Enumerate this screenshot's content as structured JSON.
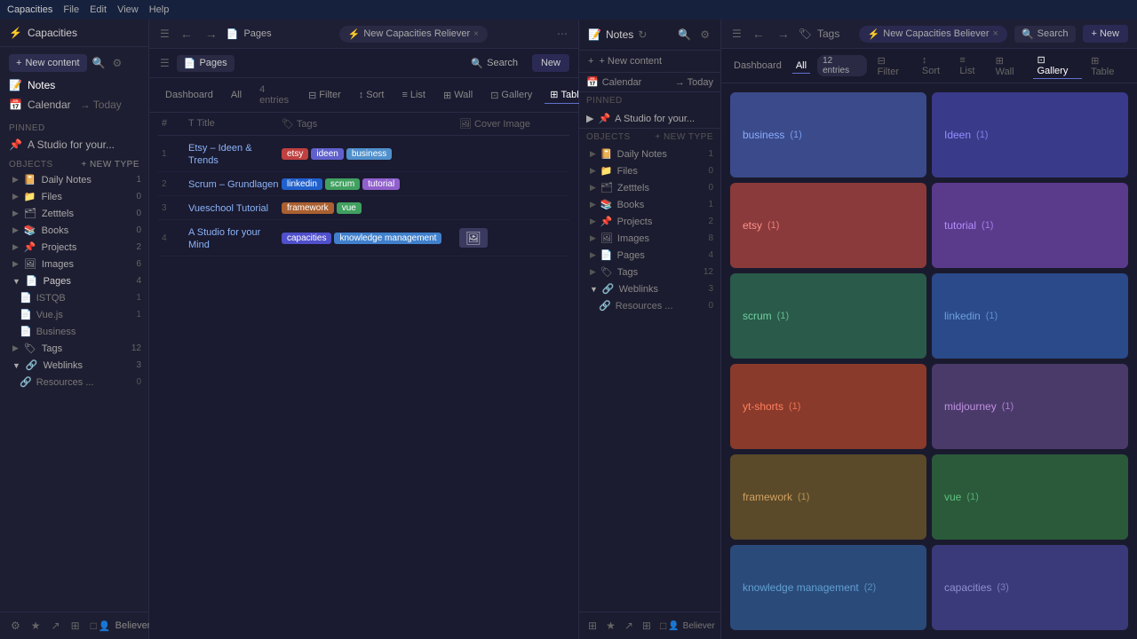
{
  "app": {
    "title": "Capacities",
    "menu": [
      "File",
      "Edit",
      "View",
      "Help"
    ]
  },
  "left_sidebar": {
    "title": "Capacities",
    "nav": [
      {
        "label": "Notes",
        "icon": "📝",
        "active": true
      },
      {
        "label": "Calendar",
        "icon": "📅"
      },
      {
        "label": "Today",
        "icon": "→"
      }
    ],
    "pinned_label": "Pinned",
    "pinned_item": "A Studio for your...",
    "objects_label": "Objects",
    "new_type_label": "+ New type",
    "objects": [
      {
        "label": "Daily Notes",
        "icon": "📔",
        "count": "1",
        "expanded": false
      },
      {
        "label": "Files",
        "icon": "📁",
        "count": "0"
      },
      {
        "label": "Zetttels",
        "icon": "🗂",
        "count": "0"
      },
      {
        "label": "Books",
        "icon": "📚",
        "count": "0"
      },
      {
        "label": "Projects",
        "icon": "📌",
        "count": "2"
      },
      {
        "label": "Images",
        "icon": "🖼",
        "count": "6"
      },
      {
        "label": "Pages",
        "icon": "📄",
        "count": "4",
        "expanded": true,
        "subitems": [
          {
            "label": "ISTQB",
            "count": "1"
          },
          {
            "label": "Vue.js",
            "count": "1"
          },
          {
            "label": "Business",
            "count": ""
          }
        ]
      },
      {
        "label": "Tags",
        "icon": "🏷",
        "count": "12"
      },
      {
        "label": "Weblinks",
        "icon": "🔗",
        "count": "3",
        "expanded": false,
        "subitems": [
          {
            "label": "Resources ...",
            "count": "0"
          }
        ]
      }
    ],
    "footer_icons": [
      "⚙",
      "★",
      "↗",
      "⊞",
      "□"
    ],
    "user": "Believer"
  },
  "center_panel": {
    "titlebar": {
      "nav_icon": "☰",
      "back": "←",
      "forward": "→",
      "breadcrumb": "Pages",
      "active_tab": "New Capacities Reliever",
      "more_icon": "⋯"
    },
    "toolbar": {
      "pages_label": "Pages",
      "search_label": "Search",
      "new_label": "New"
    },
    "view_tabs": [
      {
        "label": "Dashboard",
        "active": false
      },
      {
        "label": "All",
        "active": false
      },
      {
        "label": "4 entries",
        "active": false
      }
    ],
    "view_options": [
      {
        "label": "Filter",
        "icon": "⊟"
      },
      {
        "label": "Sort",
        "icon": "↕"
      },
      {
        "label": "List",
        "icon": "≡"
      },
      {
        "label": "Wall",
        "icon": "⊞"
      },
      {
        "label": "Gallery",
        "icon": "⊡"
      },
      {
        "label": "Table",
        "icon": "⊞",
        "active": true
      }
    ],
    "table": {
      "headers": [
        "#",
        "Title",
        "Tags",
        "Cover Image"
      ],
      "rows": [
        {
          "num": "1",
          "title": "Etsy – Ideen & Trends",
          "tags": [
            {
              "label": "etsy",
              "class": "tag-etsy"
            },
            {
              "label": "ideen",
              "class": "tag-ideen"
            },
            {
              "label": "business",
              "class": "tag-business"
            }
          ],
          "cover": ""
        },
        {
          "num": "2",
          "title": "Scrum – Grundlagen",
          "tags": [
            {
              "label": "linkedin",
              "class": "tag-linkedin"
            },
            {
              "label": "scrum",
              "class": "tag-scrum"
            },
            {
              "label": "tutorial",
              "class": "tag-tutorial"
            }
          ],
          "cover": ""
        },
        {
          "num": "3",
          "title": "Vueschool Tutorial",
          "tags": [
            {
              "label": "framework",
              "class": "tag-framework"
            },
            {
              "label": "vue",
              "class": "tag-vue"
            }
          ],
          "cover": ""
        },
        {
          "num": "4",
          "title": "A Studio for your Mind",
          "tags": [
            {
              "label": "capacities",
              "class": "tag-capacities"
            },
            {
              "label": "knowledge management",
              "class": "tag-km"
            }
          ],
          "cover": "🖼"
        }
      ]
    }
  },
  "notes_panel": {
    "title": "Notes",
    "refresh_icon": "↻",
    "search_icon": "🔍",
    "options_icon": "⚙",
    "new_content_label": "+ New content",
    "calendar_label": "Calendar",
    "today_label": "→ Today",
    "pinned_label": "Pinned",
    "pinned_item": "A Studio for your...",
    "objects_label": "Objects",
    "new_type_label": "+ New type",
    "objects": [
      {
        "label": "Daily Notes",
        "icon": "📔",
        "count": "1",
        "expanded": false
      },
      {
        "label": "Files",
        "icon": "📁",
        "count": "0"
      },
      {
        "label": "Zetttels",
        "icon": "🗂",
        "count": "0"
      },
      {
        "label": "Books",
        "icon": "📚",
        "count": "1"
      },
      {
        "label": "Projects",
        "icon": "📌",
        "count": "2"
      },
      {
        "label": "Images",
        "icon": "🖼",
        "count": "8"
      },
      {
        "label": "Pages",
        "icon": "📄",
        "count": "4"
      },
      {
        "label": "Tags",
        "icon": "🏷",
        "count": "12"
      },
      {
        "label": "Weblinks",
        "icon": "🔗",
        "count": "3",
        "expanded": true,
        "subitems": [
          {
            "label": "Resources ...",
            "count": "0"
          }
        ]
      }
    ],
    "footer_icons": [
      "⊞",
      "★",
      "↗",
      "⊞",
      "□"
    ],
    "user": "Believer"
  },
  "tags_panel": {
    "nav_icons": [
      "☰",
      "←",
      "→"
    ],
    "title": "Tags",
    "active_tab_label": "New Capacities Believer",
    "close_icon": "×",
    "search_label": "Search",
    "new_label": "+ New",
    "view_bar": {
      "dashboard_label": "Dashboard",
      "all_label": "All",
      "count_label": "12 entries",
      "options": [
        "⊟ Filter",
        "↕ Sort",
        "List",
        "Wall",
        "Gallery",
        "Table"
      ]
    },
    "tag_cards": [
      {
        "label": "business",
        "count": "(1)",
        "class": "tag-card-business"
      },
      {
        "label": "Ideen",
        "count": "(1)",
        "class": "tag-card-ideen"
      },
      {
        "label": "etsy",
        "count": "(1)",
        "class": "tag-card-etsy"
      },
      {
        "label": "tutorial",
        "count": "(1)",
        "class": "tag-card-tutorial"
      },
      {
        "label": "scrum",
        "count": "(1)",
        "class": "tag-card-scrum"
      },
      {
        "label": "linkedin",
        "count": "(1)",
        "class": "tag-card-linkedin"
      },
      {
        "label": "yt-shorts",
        "count": "(1)",
        "class": "tag-card-ytshorts"
      },
      {
        "label": "midjourney",
        "count": "(1)",
        "class": "tag-card-midjourney"
      },
      {
        "label": "framework",
        "count": "(1)",
        "class": "tag-card-framework"
      },
      {
        "label": "vue",
        "count": "(1)",
        "class": "tag-card-vue"
      },
      {
        "label": "knowledge management",
        "count": "(2)",
        "class": "tag-card-km"
      },
      {
        "label": "capacities",
        "count": "(3)",
        "class": "tag-card-capacities"
      }
    ]
  }
}
